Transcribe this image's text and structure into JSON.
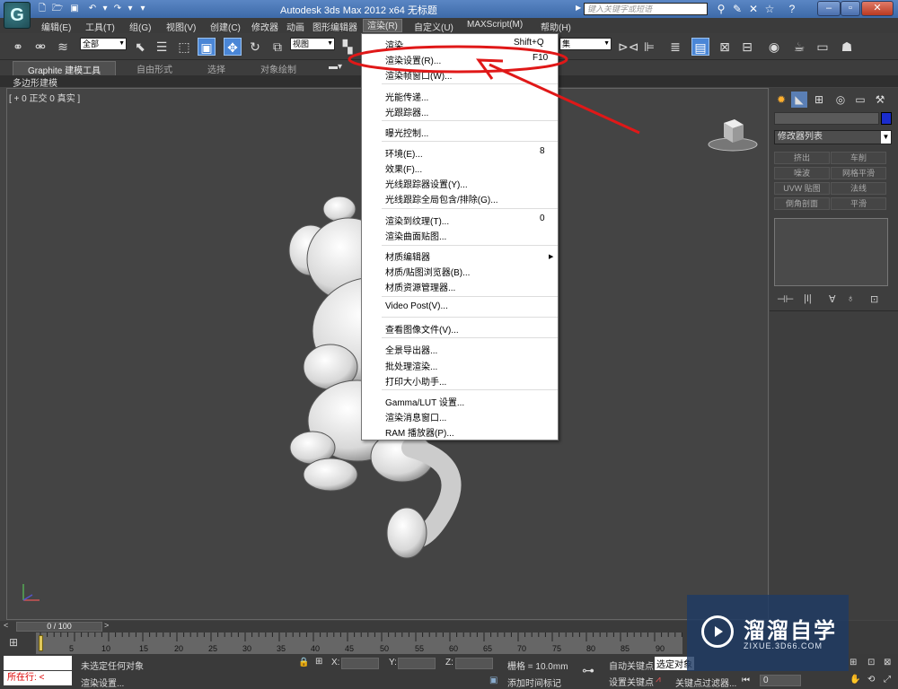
{
  "window": {
    "title": "Autodesk 3ds Max  2012 x64     无标题",
    "search_placeholder": "键入关键字或短语"
  },
  "menubar": {
    "items": [
      "编辑(E)",
      "工具(T)",
      "组(G)",
      "视图(V)",
      "创建(C)",
      "修改器",
      "动画",
      "图形编辑器",
      "渲染(R)",
      "自定义(U)",
      "MAXScript(M)",
      "帮助(H)"
    ],
    "active": "渲染(R)"
  },
  "toolbar": {
    "selection_filter": "全部",
    "ref_coord": "视图",
    "named_selection": "集"
  },
  "ribbon": {
    "tabs": [
      "Graphite 建模工具",
      "自由形式",
      "选择",
      "对象绘制"
    ],
    "active_tab": "Graphite 建模工具",
    "sub_label": "多边形建模"
  },
  "viewport": {
    "label": "[ + 0 正交 0 真实 ]"
  },
  "render_menu": {
    "items": [
      {
        "label": "渲染",
        "shortcut": "Shift+Q"
      },
      {
        "label": "渲染设置(R)...",
        "shortcut": "F10"
      },
      {
        "label": "渲染帧窗口(W)...",
        "shortcut": ""
      },
      {
        "label": "光能传递...",
        "shortcut": ""
      },
      {
        "label": "光跟踪器...",
        "shortcut": ""
      },
      {
        "label": "曝光控制...",
        "shortcut": ""
      },
      {
        "label": "环境(E)...",
        "shortcut": "8"
      },
      {
        "label": "效果(F)...",
        "shortcut": ""
      },
      {
        "label": "光线跟踪器设置(Y)...",
        "shortcut": ""
      },
      {
        "label": "光线跟踪全局包含/排除(G)...",
        "shortcut": ""
      },
      {
        "label": "渲染到纹理(T)...",
        "shortcut": "0"
      },
      {
        "label": "渲染曲面贴图...",
        "shortcut": ""
      },
      {
        "label": "材质编辑器",
        "shortcut": ""
      },
      {
        "label": "材质/贴图浏览器(B)...",
        "shortcut": ""
      },
      {
        "label": "材质资源管理器...",
        "shortcut": ""
      },
      {
        "label": "Video Post(V)...",
        "shortcut": ""
      },
      {
        "label": "查看图像文件(V)...",
        "shortcut": ""
      },
      {
        "label": "全景导出器...",
        "shortcut": ""
      },
      {
        "label": "批处理渲染...",
        "shortcut": ""
      },
      {
        "label": "打印大小助手...",
        "shortcut": ""
      },
      {
        "label": "Gamma/LUT 设置...",
        "shortcut": ""
      },
      {
        "label": "渲染消息窗口...",
        "shortcut": ""
      },
      {
        "label": "RAM 播放器(P)...",
        "shortcut": ""
      }
    ]
  },
  "command_panel": {
    "modifier_list": "修改器列表",
    "buttons": [
      "挤出",
      "车削",
      "噪波",
      "网格平滑",
      "UVW 贴图",
      "法线",
      "倒角剖面",
      "平滑"
    ]
  },
  "timeline": {
    "frame": "0 / 100",
    "prev": "<",
    "next": ">",
    "ticks": [
      "5",
      "10",
      "15",
      "20",
      "25",
      "30",
      "35",
      "40",
      "45",
      "50",
      "55",
      "60",
      "65",
      "70",
      "75",
      "80",
      "85",
      "90"
    ]
  },
  "status": {
    "selection": "未选定任何对象",
    "prompt": "渲染设置...",
    "maxscript_label": "所在行:",
    "x_label": "X:",
    "y_label": "Y:",
    "z_label": "Z:",
    "grid": "栅格 = 10.0mm",
    "add_time_tag": "添加时间标记",
    "auto_key": "自动关键点",
    "selected_obj": "选定对象",
    "set_key": "设置关键点",
    "key_filters": "关键点过滤器...",
    "frame_field": "0"
  },
  "watermark": {
    "title": "溜溜自学",
    "url": "ZIXUE.3D66.COM"
  },
  "colors": {
    "annotation": "#e01818",
    "titlebar": "#4a78b8",
    "active_tool": "#4a86d6"
  }
}
